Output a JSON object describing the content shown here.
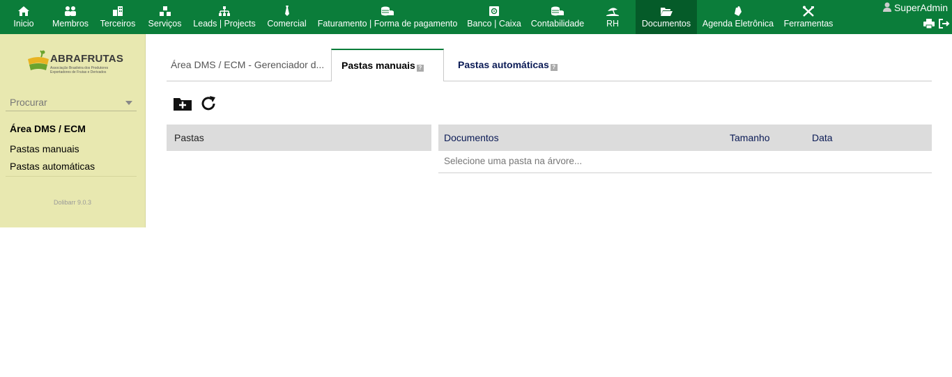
{
  "topbar": {
    "menus": [
      {
        "label": "Inicio",
        "icon": "home-icon"
      },
      {
        "label": "Membros",
        "icon": "members-icon"
      },
      {
        "label": "Terceiros",
        "icon": "building-icon"
      },
      {
        "label": "Serviços",
        "icon": "boxes-icon"
      },
      {
        "label": "Leads | Projects",
        "icon": "sitemap-icon"
      },
      {
        "label": "Comercial",
        "icon": "tie-icon"
      },
      {
        "label": "Faturamento | Forma de pagamento",
        "icon": "coins-icon"
      },
      {
        "label": "Banco | Caixa",
        "icon": "safe-icon"
      },
      {
        "label": "Contabilidade",
        "icon": "coins-stack-icon"
      },
      {
        "label": "RH",
        "icon": "umbrella-beach-icon"
      },
      {
        "label": "Documentos",
        "icon": "folder-open-icon"
      },
      {
        "label": "Agenda Eletrônica",
        "icon": "tools-icon"
      },
      {
        "label": "Ferramentas",
        "icon": "wrench-icon"
      }
    ],
    "active_menu": "Documentos",
    "user": "SuperAdmin"
  },
  "leftbar": {
    "logo": {
      "title": "ABRAFRUTAS",
      "sub1": "Associação Brasileira dos Produtores",
      "sub2": "Exportadores de Frutas e Derivados"
    },
    "search_placeholder": "Procurar",
    "heading": "Área DMS / ECM",
    "links": [
      "Pastas manuais",
      "Pastas automáticas"
    ],
    "version": "Dolibarr 9.0.3"
  },
  "tabs": [
    {
      "label": "Área DMS / ECM - Gerenciador d..."
    },
    {
      "label": "Pastas manuais"
    },
    {
      "label": "Pastas automáticas"
    }
  ],
  "help_mark": "?",
  "folders": {
    "header": "Pastas"
  },
  "documents": {
    "columns": [
      "Documentos",
      "Tamanho",
      "Data"
    ],
    "empty_message": "Selecione uma pasta na árvore..."
  },
  "colors": {
    "topbar": "#0b7d3a",
    "active_menu": "#055b29",
    "leftbar": "#e8e8b0",
    "link_blue": "#0a1a55"
  }
}
